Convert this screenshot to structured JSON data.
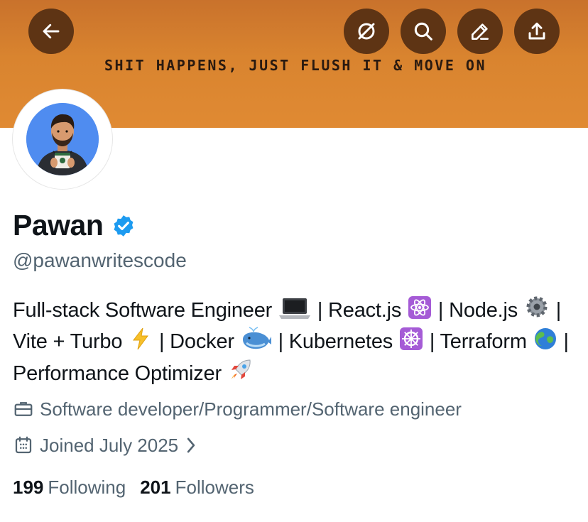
{
  "banner": {
    "text": "SHIT HAPPENS, JUST FLUSH IT & MOVE ON",
    "color": "#d9842f"
  },
  "toolbar": {
    "back_icon": "arrow-left-icon",
    "grok_icon": "slash-circle-icon",
    "search_icon": "search-icon",
    "edit_icon": "pencil-icon",
    "share_icon": "share-upload-icon",
    "button_color": "#5e3414"
  },
  "profile": {
    "display_name": "Pawan",
    "handle": "@pawanwritescode",
    "verified": true,
    "verified_color": "#1d9bf0",
    "avatar_icon": "avatar-illustration"
  },
  "bio": {
    "seg1": "Full-stack Software Engineer",
    "seg2": "| React.js",
    "seg3": "| Node.js",
    "seg4": "| Vite + Turbo",
    "seg5": "| Docker",
    "seg6": "| Kubernetes",
    "seg7": "|",
    "seg8": "Terraform",
    "seg9": "| Performance Optimizer"
  },
  "meta": {
    "profession": "Software developer/Programmer/Software engineer",
    "profession_icon": "briefcase-icon",
    "joined": "Joined July 2025",
    "joined_icon": "calendar-icon"
  },
  "stats": {
    "following_count": "199",
    "following_label": "Following",
    "followers_count": "201",
    "followers_label": "Followers"
  }
}
